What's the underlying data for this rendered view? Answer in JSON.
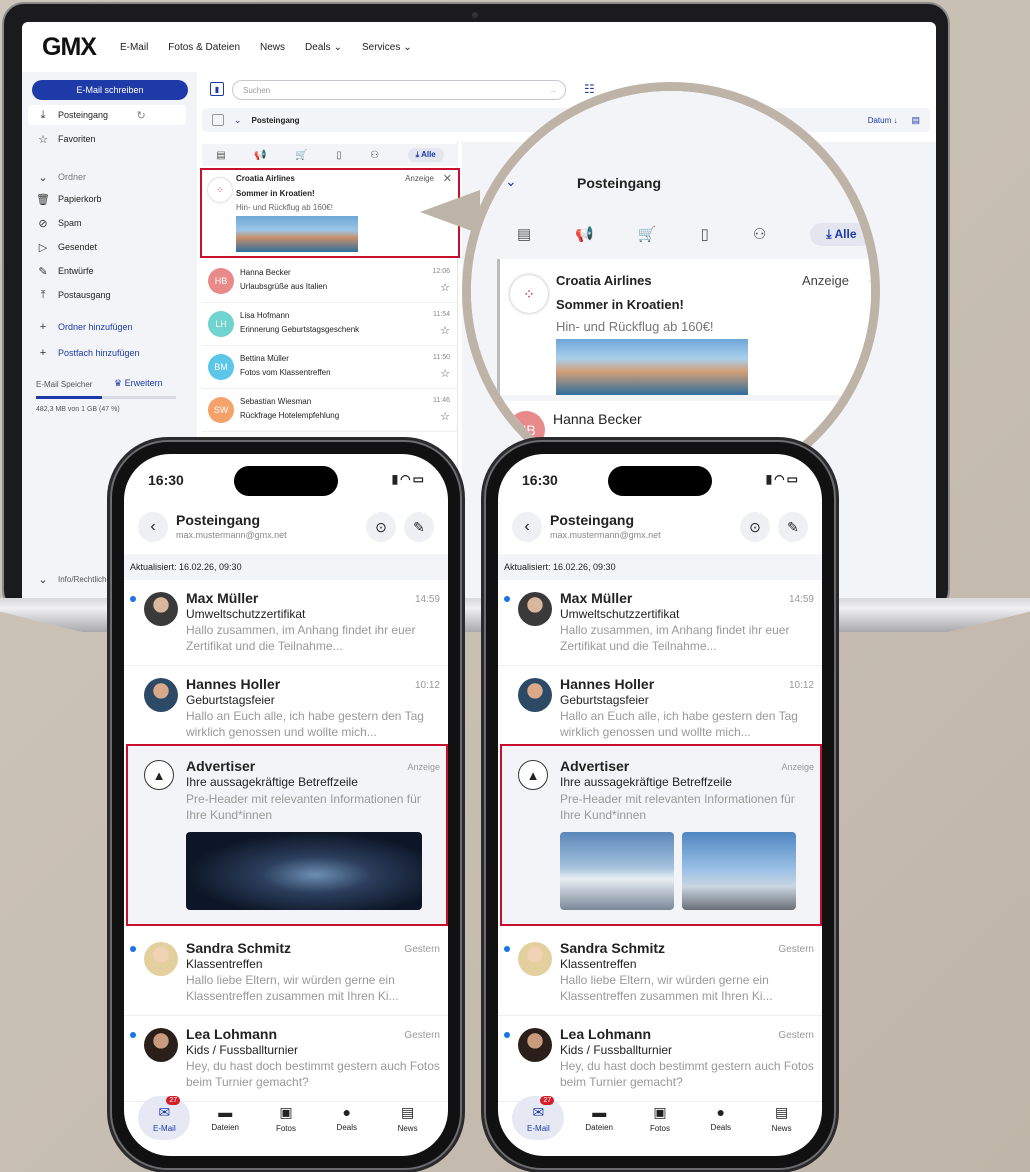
{
  "laptop": {
    "logo": "GMX",
    "nav": [
      "E-Mail",
      "Fotos & Dateien",
      "News",
      "Deals",
      "Services"
    ],
    "compose_label": "E-Mail schreiben",
    "search_placeholder": "Suchen",
    "folder_current": "Posteingang",
    "sort_label": "Datum",
    "sidebar": {
      "inbox": "Posteingang",
      "favorites": "Favoriten",
      "folders_header": "Ordner",
      "folders": [
        "Papierkorb",
        "Spam",
        "Gesendet",
        "Entwürfe",
        "Postausgang"
      ],
      "add_folder": "Ordner hinzufügen",
      "add_mailbox": "Postfach hinzufügen",
      "storage_label": "E-Mail Speicher",
      "upgrade": "Erweitern",
      "storage_text": "482,3 MB von 1 GB (47 %)",
      "storage_fraction": 0.47,
      "footer": "Info/Rechtliches"
    },
    "tabs_all": "Alle",
    "ad": {
      "from": "Croatia Airlines",
      "subject": "Sommer in Kroatien!",
      "preview": "Hin- und Rückflug ab 160€!",
      "tag": "Anzeige"
    },
    "mails": [
      {
        "initials": "HB",
        "from": "Hanna Becker",
        "subject": "Urlaubsgrüße aus Italien",
        "time": "12:06",
        "color": "#e98a8a"
      },
      {
        "initials": "LH",
        "from": "Lisa Hofmann",
        "subject": "Erinnerung Geburtstagsgeschenk",
        "time": "11:54",
        "color": "#6fd3d0"
      },
      {
        "initials": "BM",
        "from": "Bettina Müller",
        "subject": "Fotos vom Klassentreffen",
        "time": "11:50",
        "color": "#5bc6e8"
      },
      {
        "initials": "SW",
        "from": "Sebastian Wiesman",
        "subject": "Rückfrage Hotelempfehlung",
        "time": "11:46",
        "color": "#f5a26a"
      }
    ]
  },
  "lens": {
    "folder": "Posteingang",
    "tab_all": "Alle",
    "ad_from": "Croatia Airlines",
    "ad_subject": "Sommer in Kroatien!",
    "ad_preview": "Hin- und Rückflug ab 160€!",
    "ad_tag": "Anzeige",
    "mail_initials": "HB",
    "mail_from": "Hanna Becker",
    "mail_subject": "Urlaubsgrüße aus Italien",
    "mail_time": "12:06"
  },
  "phone": {
    "time": "16:30",
    "title": "Posteingang",
    "address": "max.mustermann@gmx.net",
    "updated": "Aktualisiert: 16.02.26, 09:30",
    "mails": [
      {
        "from": "Max Müller",
        "time": "14:59",
        "subject": "Umweltschutzzertifikat",
        "preview": "Hallo zusammen, im Anhang findet ihr euer Zertifikat und die Teilnahme..."
      },
      {
        "from": "Hannes Holler",
        "time": "10:12",
        "subject": "Geburtstagsfeier",
        "preview": "Hallo an Euch alle, ich habe gestern den Tag wirklich genossen und wollte mich..."
      }
    ],
    "ad": {
      "from": "Advertiser",
      "tag": "Anzeige",
      "subject": "Ihre aussagekräftige Betreffzeile",
      "preview": "Pre-Header mit relevanten Informationen für Ihre Kund*innen"
    },
    "mails2": [
      {
        "from": "Sandra Schmitz",
        "time": "Gestern",
        "subject": "Klassentreffen",
        "preview": "Hallo liebe Eltern, wir würden gerne ein Klassentreffen zusammen mit Ihren Ki..."
      },
      {
        "from": "Lea Lohmann",
        "time": "Gestern",
        "subject": "Kids / Fussballturnier",
        "preview": "Hey, du hast doch bestimmt gestern auch Fotos beim Turnier gemacht?"
      }
    ],
    "tabbar": [
      {
        "label": "E-Mail",
        "badge": "27"
      },
      {
        "label": "Dateien"
      },
      {
        "label": "Fotos"
      },
      {
        "label": "Deals"
      },
      {
        "label": "News"
      }
    ]
  }
}
